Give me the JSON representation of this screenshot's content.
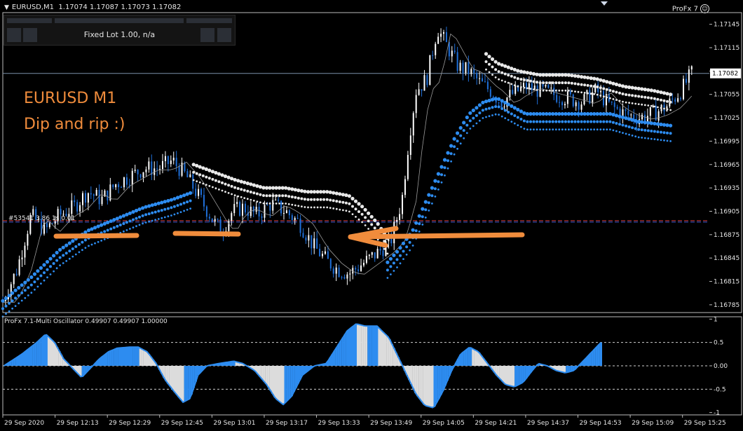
{
  "header": {
    "symbol": "EURUSD,M1",
    "ohlc": "1.17074 1.17087 1.17073 1.17082",
    "indicator_name": "ProFx 7"
  },
  "panel": {
    "lot_label": "Fixed Lot 1.00, n/a"
  },
  "annotation": {
    "line1": "EURUSD M1",
    "line2": "Dip and rip :)"
  },
  "colors": {
    "background": "#000000",
    "candle_up": "#ffffff",
    "candle_down": "#1f6fd8",
    "dots_blue": "#2d8cf0",
    "dots_white": "#e8e8e8",
    "osc_blue": "#2d8cf0",
    "osc_grey": "#dcdcdc",
    "annotation_orange": "#f08c3c",
    "order_line_red": "#d23c3c",
    "order_line_blue": "#3c5ad2",
    "price_line": "#7a8fa8"
  },
  "chart_data": [
    {
      "type": "candlestick",
      "symbol": "EURUSD",
      "timeframe": "M1",
      "ylim": [
        1.16775,
        1.1716
      ],
      "y_ticks": [
        "1.17145",
        "1.17115",
        "1.17085",
        "1.17055",
        "1.17025",
        "1.16995",
        "1.16965",
        "1.16935",
        "1.16905",
        "1.16875",
        "1.16845",
        "1.16815",
        "1.16785"
      ],
      "y_tick_values": [
        1.17145,
        1.17115,
        1.17085,
        1.17055,
        1.17025,
        1.16995,
        1.16965,
        1.16935,
        1.16905,
        1.16875,
        1.16845,
        1.16815,
        1.16785
      ],
      "current_price": 1.17082,
      "current_price_label": "1.17082",
      "order_line_price": 1.16892,
      "order_line_label": "#53541 3.86 1s 0.01",
      "x_ticks": [
        "29 Sep 2020",
        "29 Sep 12:13",
        "29 Sep 12:29",
        "29 Sep 12:45",
        "29 Sep 13:01",
        "29 Sep 13:17",
        "29 Sep 13:33",
        "29 Sep 13:49",
        "29 Sep 14:05",
        "29 Sep 14:21",
        "29 Sep 14:37",
        "29 Sep 14:53",
        "29 Sep 15:09",
        "29 Sep 15:25"
      ],
      "x_tick_positions": [
        0.0,
        0.074,
        0.148,
        0.222,
        0.296,
        0.37,
        0.444,
        0.518,
        0.592,
        0.666,
        0.74,
        0.814,
        0.888,
        0.962
      ],
      "close_path": [
        [
          0.0,
          1.1679
        ],
        [
          0.02,
          1.1683
        ],
        [
          0.04,
          1.169
        ],
        [
          0.06,
          1.1688
        ],
        [
          0.08,
          1.169
        ],
        [
          0.1,
          1.1691
        ],
        [
          0.12,
          1.1693
        ],
        [
          0.14,
          1.1692
        ],
        [
          0.16,
          1.1694
        ],
        [
          0.18,
          1.1695
        ],
        [
          0.2,
          1.1696
        ],
        [
          0.22,
          1.1696
        ],
        [
          0.24,
          1.1697
        ],
        [
          0.26,
          1.1695
        ],
        [
          0.28,
          1.1692
        ],
        [
          0.3,
          1.1689
        ],
        [
          0.31,
          1.1688
        ],
        [
          0.325,
          1.16905
        ],
        [
          0.34,
          1.1691
        ],
        [
          0.36,
          1.169
        ],
        [
          0.38,
          1.16915
        ],
        [
          0.4,
          1.16905
        ],
        [
          0.42,
          1.1689
        ],
        [
          0.44,
          1.1686
        ],
        [
          0.46,
          1.1684
        ],
        [
          0.475,
          1.1683
        ],
        [
          0.49,
          1.16825
        ],
        [
          0.505,
          1.16835
        ],
        [
          0.52,
          1.16845
        ],
        [
          0.535,
          1.16855
        ],
        [
          0.55,
          1.1687
        ],
        [
          0.565,
          1.1692
        ],
        [
          0.575,
          1.17
        ],
        [
          0.585,
          1.1706
        ],
        [
          0.6,
          1.17075
        ],
        [
          0.615,
          1.1714
        ],
        [
          0.63,
          1.17115
        ],
        [
          0.645,
          1.1709
        ],
        [
          0.66,
          1.17085
        ],
        [
          0.675,
          1.1707
        ],
        [
          0.69,
          1.1706
        ],
        [
          0.705,
          1.17045
        ],
        [
          0.72,
          1.17055
        ],
        [
          0.74,
          1.17065
        ],
        [
          0.76,
          1.1706
        ],
        [
          0.78,
          1.17055
        ],
        [
          0.8,
          1.1705
        ],
        [
          0.82,
          1.17045
        ],
        [
          0.84,
          1.1706
        ],
        [
          0.86,
          1.1704
        ],
        [
          0.88,
          1.1703
        ],
        [
          0.9,
          1.17025
        ],
        [
          0.92,
          1.1703
        ],
        [
          0.94,
          1.1704
        ],
        [
          0.96,
          1.1706
        ],
        [
          0.975,
          1.17082
        ]
      ],
      "upper_band": [
        [
          0.27,
          1.16965
        ],
        [
          0.3,
          1.16955
        ],
        [
          0.33,
          1.16945
        ],
        [
          0.37,
          1.16935
        ],
        [
          0.4,
          1.16935
        ],
        [
          0.43,
          1.1693
        ],
        [
          0.46,
          1.1693
        ],
        [
          0.49,
          1.16925
        ],
        [
          0.51,
          1.1691
        ],
        [
          0.53,
          1.1689
        ],
        [
          0.545,
          1.1687
        ],
        [
          0.68,
          1.1711
        ],
        [
          0.7,
          1.17095
        ],
        [
          0.73,
          1.17085
        ],
        [
          0.76,
          1.1708
        ],
        [
          0.8,
          1.1708
        ],
        [
          0.84,
          1.17075
        ],
        [
          0.88,
          1.17065
        ],
        [
          0.92,
          1.1706
        ],
        [
          0.945,
          1.17055
        ]
      ],
      "lower_band": [
        [
          0.0,
          1.1679
        ],
        [
          0.04,
          1.1682
        ],
        [
          0.08,
          1.16855
        ],
        [
          0.12,
          1.1688
        ],
        [
          0.16,
          1.16895
        ],
        [
          0.2,
          1.1691
        ],
        [
          0.24,
          1.1692
        ],
        [
          0.27,
          1.1693
        ],
        [
          0.54,
          1.16835
        ],
        [
          0.56,
          1.16855
        ],
        [
          0.58,
          1.1688
        ],
        [
          0.6,
          1.1692
        ],
        [
          0.62,
          1.1696
        ],
        [
          0.64,
          1.17
        ],
        [
          0.66,
          1.1703
        ],
        [
          0.68,
          1.17045
        ],
        [
          0.7,
          1.1705
        ],
        [
          0.74,
          1.1703
        ],
        [
          0.78,
          1.1703
        ],
        [
          0.82,
          1.1703
        ],
        [
          0.86,
          1.1703
        ],
        [
          0.9,
          1.1702
        ],
        [
          0.945,
          1.17015
        ]
      ]
    },
    {
      "type": "area",
      "title": "ProFx 7.1-Multi Oscillator 0.49907 0.49907 1.00000",
      "ylim": [
        -1.05,
        1.05
      ],
      "y_ticks": [
        "1",
        "0.5",
        "0.00",
        "-0.5",
        "-1"
      ],
      "y_tick_values": [
        1.0,
        0.5,
        0.0,
        -0.5,
        -1.0
      ],
      "levels": [
        0.5,
        0.0,
        -0.5
      ],
      "series": [
        [
          0.0,
          0.0
        ],
        [
          0.03,
          0.25
        ],
        [
          0.055,
          0.5
        ],
        [
          0.07,
          0.68
        ],
        [
          0.085,
          0.5
        ],
        [
          0.1,
          0.15
        ],
        [
          0.115,
          -0.05
        ],
        [
          0.13,
          -0.25
        ],
        [
          0.145,
          -0.05
        ],
        [
          0.16,
          0.15
        ],
        [
          0.175,
          0.3
        ],
        [
          0.19,
          0.38
        ],
        [
          0.21,
          0.4
        ],
        [
          0.225,
          0.4
        ],
        [
          0.24,
          0.3
        ],
        [
          0.255,
          0.05
        ],
        [
          0.27,
          -0.3
        ],
        [
          0.285,
          -0.55
        ],
        [
          0.3,
          -0.78
        ],
        [
          0.312,
          -0.7
        ],
        [
          0.325,
          -0.2
        ],
        [
          0.34,
          0.0
        ],
        [
          0.36,
          0.05
        ],
        [
          0.385,
          0.1
        ],
        [
          0.4,
          0.05
        ],
        [
          0.42,
          -0.1
        ],
        [
          0.44,
          -0.4
        ],
        [
          0.455,
          -0.7
        ],
        [
          0.468,
          -0.83
        ],
        [
          0.482,
          -0.65
        ],
        [
          0.5,
          -0.2
        ],
        [
          0.52,
          0.0
        ],
        [
          0.54,
          0.05
        ],
        [
          0.56,
          0.45
        ],
        [
          0.575,
          0.75
        ],
        [
          0.59,
          0.9
        ],
        [
          0.605,
          0.85
        ],
        [
          0.625,
          0.85
        ],
        [
          0.645,
          0.6
        ],
        [
          0.66,
          0.2
        ],
        [
          0.675,
          -0.2
        ],
        [
          0.69,
          -0.6
        ],
        [
          0.705,
          -0.85
        ],
        [
          0.72,
          -0.9
        ],
        [
          0.735,
          -0.55
        ],
        [
          0.75,
          -0.1
        ],
        [
          0.765,
          0.25
        ],
        [
          0.78,
          0.4
        ],
        [
          0.795,
          0.3
        ],
        [
          0.81,
          0.05
        ],
        [
          0.825,
          -0.2
        ],
        [
          0.84,
          -0.4
        ],
        [
          0.855,
          -0.45
        ],
        [
          0.87,
          -0.35
        ],
        [
          0.885,
          -0.1
        ],
        [
          0.895,
          0.05
        ],
        [
          0.91,
          0.0
        ],
        [
          0.925,
          -0.1
        ],
        [
          0.94,
          -0.15
        ],
        [
          0.955,
          -0.1
        ],
        [
          0.97,
          0.1
        ],
        [
          0.985,
          0.3
        ],
        [
          1.0,
          0.5
        ]
      ]
    }
  ]
}
